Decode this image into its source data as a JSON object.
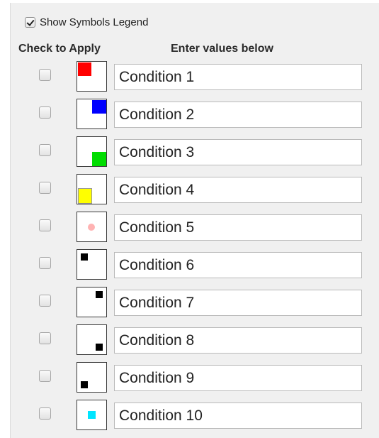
{
  "show_legend": {
    "label": "Show Symbols Legend",
    "checked": true
  },
  "headers": {
    "check_to_apply": "Check to Apply",
    "enter_values": "Enter values below"
  },
  "conditions": [
    {
      "value": "Condition 1",
      "checked": false,
      "symbol": "red-square-top-left",
      "color": "#ff0000"
    },
    {
      "value": "Condition 2",
      "checked": false,
      "symbol": "blue-square-top-right",
      "color": "#0000ff"
    },
    {
      "value": "Condition 3",
      "checked": false,
      "symbol": "green-square-bottom-right",
      "color": "#00dd00"
    },
    {
      "value": "Condition 4",
      "checked": false,
      "symbol": "yellow-square-bottom-left",
      "color": "#ffff00"
    },
    {
      "value": "Condition 5",
      "checked": false,
      "symbol": "pink-dot-center",
      "color": "#ffb3b3"
    },
    {
      "value": "Condition 6",
      "checked": false,
      "symbol": "black-small-square-top-left",
      "color": "#000000"
    },
    {
      "value": "Condition 7",
      "checked": false,
      "symbol": "black-small-square-top-right",
      "color": "#000000"
    },
    {
      "value": "Condition 8",
      "checked": false,
      "symbol": "black-small-square-bottom-right",
      "color": "#000000"
    },
    {
      "value": "Condition 9",
      "checked": false,
      "symbol": "black-small-square-bottom-left",
      "color": "#000000"
    },
    {
      "value": "Condition 10",
      "checked": false,
      "symbol": "cyan-small-square-center",
      "color": "#00e5ff"
    }
  ]
}
